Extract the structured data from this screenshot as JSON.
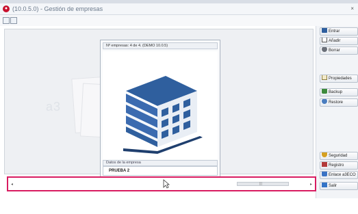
{
  "window": {
    "app_icon": "app-logo-icon",
    "title": "(10.0.5.0) - Gestión de empresas",
    "close": "×"
  },
  "toolbar": {
    "icons": [
      "grid-view-icon",
      "list-view-icon"
    ]
  },
  "panel": {
    "header": "Nº empresas: 4 de 4. (DEMO 10.0.5)",
    "image_icon": "building-icon",
    "section_label": "Datos de la empresa",
    "company_name": "PRUEBA 2"
  },
  "sidebar": {
    "buttons": [
      {
        "label": "Entrar",
        "icon": "building-icon"
      },
      {
        "label": "Añadir",
        "icon": "new-page-icon"
      },
      {
        "label": "Borrar",
        "icon": "eraser-icon"
      },
      {
        "label": "Propiedades",
        "icon": "properties-icon"
      },
      {
        "label": "Backup",
        "icon": "backup-icon"
      },
      {
        "label": "Restore",
        "icon": "restore-icon"
      },
      {
        "label": "Seguridad",
        "icon": "security-icon"
      },
      {
        "label": "Registro",
        "icon": "register-icon"
      },
      {
        "label": "Enlace a3ECO",
        "icon": "link-icon"
      },
      {
        "label": "Salir",
        "icon": "exit-icon"
      }
    ]
  },
  "scrollbar": {
    "left_arrow": "◂",
    "right_arrow": "▸",
    "grip": "|||"
  },
  "colors": {
    "highlight": "#d81b60",
    "building_blue": "#2f5f9e",
    "app_icon_red": "#c8102e"
  }
}
